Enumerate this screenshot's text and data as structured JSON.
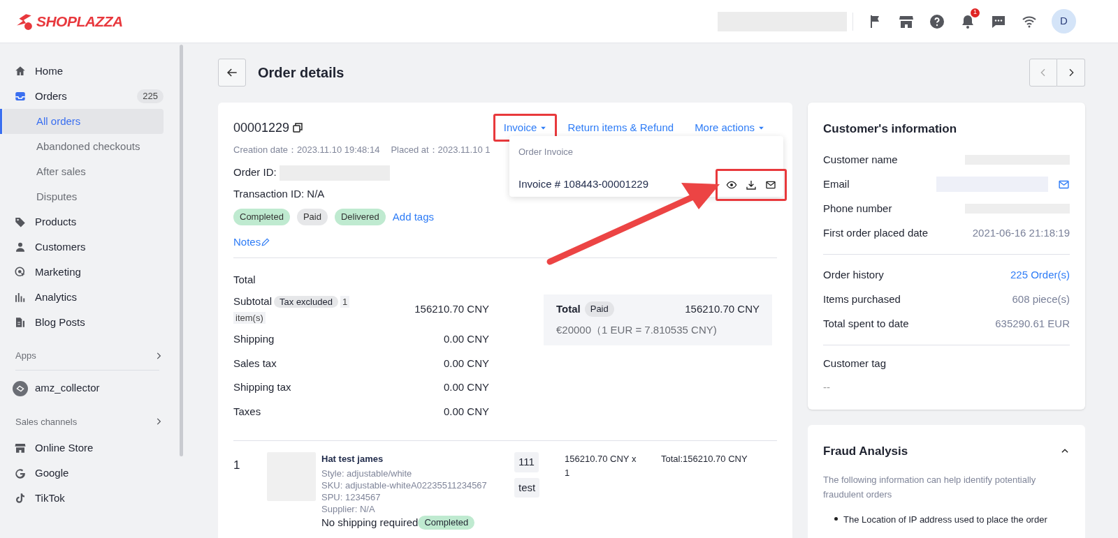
{
  "header": {
    "logo": "SHOPLAZZA",
    "notification_count": "1",
    "avatar": "D"
  },
  "sidebar": {
    "items": [
      {
        "label": "Home",
        "selected": false
      },
      {
        "label": "Orders",
        "badge": "225",
        "selected": false,
        "expanded": true,
        "children": [
          {
            "label": "All orders",
            "selected": true
          },
          {
            "label": "Abandoned checkouts",
            "selected": false
          },
          {
            "label": "After sales",
            "selected": false
          },
          {
            "label": "Disputes",
            "selected": false
          }
        ]
      },
      {
        "label": "Products",
        "selected": false
      },
      {
        "label": "Customers",
        "selected": false
      },
      {
        "label": "Marketing",
        "selected": false
      },
      {
        "label": "Analytics",
        "selected": false
      },
      {
        "label": "Blog Posts",
        "selected": false
      }
    ],
    "sections": [
      {
        "title": "Apps",
        "items": [
          {
            "label": "amz_collector"
          }
        ]
      },
      {
        "title": "Sales channels",
        "items": [
          {
            "label": "Online Store"
          },
          {
            "label": "Google"
          },
          {
            "label": "TikTok"
          }
        ]
      }
    ]
  },
  "page": {
    "title": "Order details"
  },
  "order": {
    "number": "00001229",
    "creation_label": "Creation date：",
    "creation_date": "2023.11.10 19:48:14",
    "placed_label": "Placed at：",
    "placed_at": "2023.11.10 1",
    "order_id_label": "Order ID:",
    "transaction": "Transaction ID: N/A",
    "tags": [
      {
        "label": "Completed",
        "color": "#bfead0"
      },
      {
        "label": "Paid",
        "color": "#e6e7e9"
      },
      {
        "label": "Delivered",
        "color": "#bfead0"
      }
    ],
    "add_tags": "Add tags",
    "notes": "Notes",
    "actions": [
      {
        "label": "Invoice",
        "highlighted": true
      },
      {
        "label": "Return items & Refund",
        "caret": false,
        "highlighted": false
      },
      {
        "label": "More actions",
        "caret": true,
        "highlighted": false
      }
    ],
    "invoice_menu": {
      "header": "Order Invoice",
      "item": "Invoice # 108443-00001229"
    }
  },
  "totals": {
    "title": "Total",
    "rows": [
      {
        "label": "Subtotal",
        "badge": "Tax excluded",
        "note": "1 item(s)",
        "value": "156210.70 CNY"
      },
      {
        "label": "Shipping",
        "value": "0.00 CNY"
      },
      {
        "label": "Sales tax",
        "value": "0.00 CNY"
      },
      {
        "label": "Shipping tax",
        "value": "0.00 CNY"
      },
      {
        "label": "Taxes",
        "value": "0.00 CNY"
      }
    ],
    "summary": {
      "label": "Total",
      "badge": "Paid",
      "value": "156210.70 CNY",
      "conversion": "€20000（1 EUR = 7.810535 CNY)"
    }
  },
  "line_item": {
    "index": "1",
    "name": "Hat test james",
    "details": [
      "Style: adjustable/white",
      "SKU: adjustable-whiteA02235511234567",
      "SPU: 1234567",
      "Supplier: N/A"
    ],
    "tags": [
      "111",
      "test"
    ],
    "price": "156210.70 CNY x 1",
    "total": "Total:156210.70 CNY",
    "shipping": "No shipping required",
    "status": "Completed"
  },
  "customer": {
    "title": "Customer's information",
    "rows": [
      {
        "label": "Customer name",
        "kind": "redacted"
      },
      {
        "label": "Email",
        "kind": "redacted_email"
      },
      {
        "label": "Phone number",
        "kind": "redacted"
      },
      {
        "label": "First order placed date",
        "kind": "text",
        "value": "2021-06-16 21:18:19"
      }
    ],
    "stats": [
      {
        "label": "Order history",
        "kind": "link",
        "value": "225 Order(s)"
      },
      {
        "label": "Items purchased",
        "kind": "text",
        "value": "608 piece(s)"
      },
      {
        "label": "Total spent to date",
        "kind": "text",
        "value": "635290.61 EUR"
      }
    ],
    "tag_label": "Customer tag",
    "tag_value": "--"
  },
  "fraud": {
    "title": "Fraud Analysis",
    "expanded": true,
    "description": "The following information can help identify potentially fraudulent orders",
    "bullets": [
      "The Location of IP address used to place the order"
    ]
  }
}
